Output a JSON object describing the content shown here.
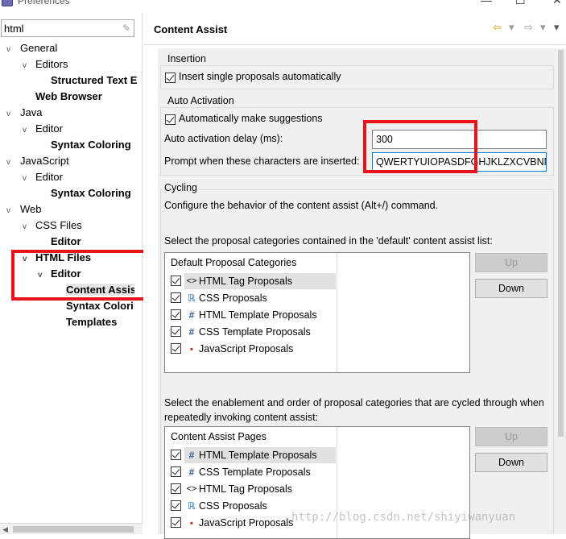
{
  "window": {
    "title": "Preferences",
    "minimize": "—",
    "maximize": "☐",
    "close": "✕"
  },
  "filter": {
    "value": "html",
    "clear_icon": "✎"
  },
  "tree": [
    {
      "label": "General",
      "twisty": "v",
      "bold": false
    },
    {
      "label": "Editors",
      "twisty": "v",
      "bold": false
    },
    {
      "label": "Structured Text E",
      "twisty": "",
      "bold": true
    },
    {
      "label": "Web Browser",
      "twisty": "",
      "bold": true
    },
    {
      "label": "Java",
      "twisty": "v",
      "bold": false
    },
    {
      "label": "Editor",
      "twisty": "v",
      "bold": false
    },
    {
      "label": "Syntax Coloring",
      "twisty": "",
      "bold": true
    },
    {
      "label": "JavaScript",
      "twisty": "v",
      "bold": false
    },
    {
      "label": "Editor",
      "twisty": "v",
      "bold": false
    },
    {
      "label": "Syntax Coloring",
      "twisty": "",
      "bold": true
    },
    {
      "label": "Web",
      "twisty": "v",
      "bold": false
    },
    {
      "label": "CSS Files",
      "twisty": "v",
      "bold": false
    },
    {
      "label": "Editor",
      "twisty": "",
      "bold": true
    },
    {
      "label": "HTML Files",
      "twisty": "v",
      "bold": true
    },
    {
      "label": "Editor",
      "twisty": "v",
      "bold": true
    },
    {
      "label": "Content Assis",
      "twisty": "",
      "bold": true,
      "selected": true
    },
    {
      "label": "Syntax Colori",
      "twisty": "",
      "bold": true
    },
    {
      "label": "Templates",
      "twisty": "",
      "bold": true
    }
  ],
  "page": {
    "title": "Content Assist",
    "nav_back": "⇦",
    "nav_forward": "⇨",
    "menu": "▾"
  },
  "insertion": {
    "group_label": "Insertion",
    "insert_single": "Insert single proposals automatically"
  },
  "auto_activation": {
    "group_label": "Auto Activation",
    "make_suggestions": "Automatically make suggestions",
    "delay_label": "Auto activation delay (ms):",
    "delay_value": "300",
    "prompt_label": "Prompt when these characters are inserted:",
    "prompt_value": "QWERTYUIOPASDFGHJKLZXCVBNM"
  },
  "cycling": {
    "group_label": "Cycling",
    "description": "Configure the behavior of the content assist (Alt+/) command."
  },
  "default_list": {
    "caption": "Select the proposal categories contained in the 'default' content assist list:",
    "header": "Default Proposal Categories",
    "items": [
      {
        "label": "HTML Tag Proposals",
        "icon": "<>",
        "checked": true
      },
      {
        "label": "CSS Proposals",
        "icon": "ℝ",
        "checked": true
      },
      {
        "label": "HTML Template Proposals",
        "icon": "#",
        "checked": true
      },
      {
        "label": "CSS Template Proposals",
        "icon": "#",
        "checked": true
      },
      {
        "label": "JavaScript Proposals",
        "icon": "▪",
        "checked": true
      }
    ],
    "up": "Up",
    "down": "Down"
  },
  "cycle_list": {
    "caption": "Select the enablement and order of proposal categories that are cycled through when repeatedly invoking content assist:",
    "header": "Content Assist Pages",
    "items": [
      {
        "label": "HTML Template Proposals",
        "icon": "#",
        "checked": true
      },
      {
        "label": "CSS Template Proposals",
        "icon": "#",
        "checked": true
      },
      {
        "label": "HTML Tag Proposals",
        "icon": "<>",
        "checked": true
      },
      {
        "label": "CSS Proposals",
        "icon": "ℝ",
        "checked": true
      },
      {
        "label": "JavaScript Proposals",
        "icon": "▪",
        "checked": true
      }
    ],
    "up": "Up",
    "down": "Down"
  },
  "watermark": "http://blog.csdn.net/shiyiwanyuan",
  "colors": {
    "highlight_red": "#e8141c",
    "panel_gray": "#f0f0f0",
    "selection_gray": "#e1e1e1"
  }
}
